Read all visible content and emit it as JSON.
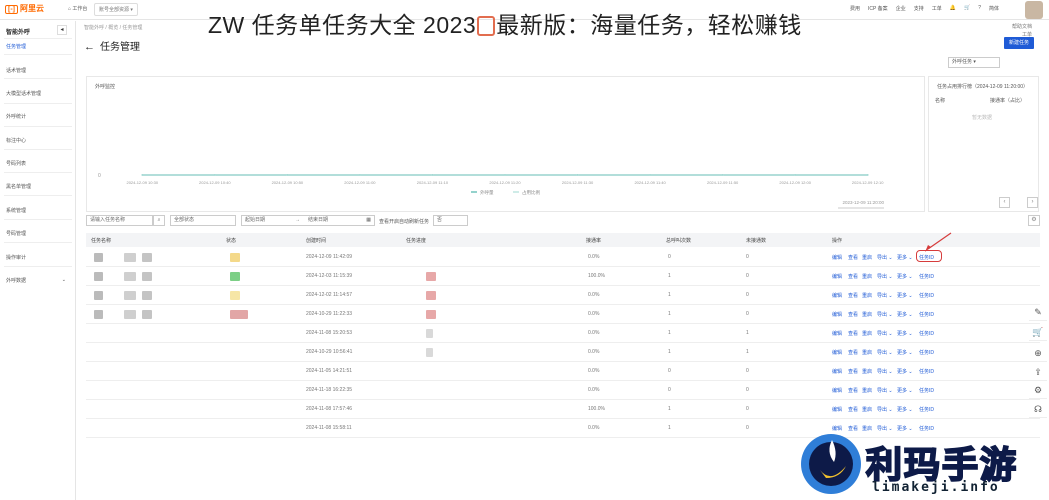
{
  "headline": {
    "prefix": "ZW 任务单任务大全 2023",
    "suffix": "最新版：海量任务，轻松赚钱"
  },
  "topbar": {
    "logo": "阿里云",
    "nav_home": "工作台",
    "search_placeholder": "账号全部资源",
    "right_items": [
      "费用",
      "ICP 备案",
      "企业",
      "支持",
      "工单",
      "简体"
    ]
  },
  "sidebar": {
    "heading": "智能外呼",
    "items": [
      {
        "label": "任务管理",
        "active": true
      },
      {
        "label": "话术管理",
        "active": false
      },
      {
        "label": "大模型话术管理",
        "active": false
      },
      {
        "label": "外呼统计",
        "active": false
      },
      {
        "label": "标注中心",
        "active": false
      },
      {
        "label": "号码列表",
        "active": false
      },
      {
        "label": "黑名单管理",
        "active": false
      },
      {
        "label": "系统管理",
        "active": false
      },
      {
        "label": "号码管理",
        "active": false
      },
      {
        "label": "操作审计",
        "active": false
      },
      {
        "label": "外呼数据",
        "active": false
      }
    ]
  },
  "breadcrumb": [
    "智能外呼",
    "概览",
    "任务管理"
  ],
  "page": {
    "title": "任务管理",
    "right_links": [
      "帮助文档",
      "工单"
    ],
    "create_button": "新建任务",
    "scope_select": "外呼任务"
  },
  "monitor_panel": {
    "title": "外呼监控",
    "legend": [
      "外呼量",
      "占用比例"
    ],
    "footer": "2023-12-09 11:20:00"
  },
  "chart_data": {
    "type": "line",
    "title": "外呼监控",
    "x": [
      "2024-12-09 10:30",
      "2024-12-09 10:40",
      "2024-12-09 10:50",
      "2024-12-09 11:00",
      "2024-12-09 11:10",
      "2024-12-09 11:20",
      "2024-12-09 11:30",
      "2024-12-09 11:40",
      "2024-12-09 11:50",
      "2024-12-09 12:00",
      "2024-12-09 12:10"
    ],
    "series": [
      {
        "name": "外呼量",
        "values": [
          0,
          0,
          0,
          0,
          0,
          0,
          0,
          0,
          0,
          0,
          0
        ]
      },
      {
        "name": "占用比例",
        "values": [
          0,
          0,
          0,
          0,
          0,
          0,
          0,
          0,
          0,
          0,
          0
        ]
      }
    ],
    "y_tick": "0",
    "grid": false,
    "legend_position": "bottom"
  },
  "rank_panel": {
    "title": "任务占用排行榜（2024-12-09 11:20:00）",
    "columns": [
      "名称",
      "接通率（占比）"
    ],
    "empty_text": "暂无数据"
  },
  "filters": {
    "search_placeholder": "请输入任务名称",
    "status_placeholder": "全部状态",
    "date_start": "起始日期",
    "date_end": "结束日期",
    "toggle_label": "查看开启自动刷新任务",
    "toggle_value": "否"
  },
  "table": {
    "columns": [
      "任务名称",
      "状态",
      "创建时间",
      "任务进度",
      "接通率",
      "总呼叫次数",
      "未接通数",
      "操作"
    ],
    "rows": [
      {
        "created": "2024-12-09 11:42:09",
        "rate": "0.0%",
        "calls": "0",
        "missed": "0",
        "highlight": true
      },
      {
        "created": "2024-12-03 11:15:39",
        "rate": "100.0%",
        "calls": "1",
        "missed": "0",
        "highlight": false
      },
      {
        "created": "2024-12-02 11:14:57",
        "rate": "0.0%",
        "calls": "1",
        "missed": "0",
        "highlight": false
      },
      {
        "created": "2024-10-29 11:22:33",
        "rate": "0.0%",
        "calls": "1",
        "missed": "0",
        "highlight": false
      },
      {
        "created": "2024-11-08 15:20:53",
        "rate": "0.0%",
        "calls": "1",
        "missed": "1",
        "highlight": false
      },
      {
        "created": "2024-10-29 10:56:41",
        "rate": "0.0%",
        "calls": "1",
        "missed": "1",
        "highlight": false
      },
      {
        "created": "2024-11-05 14:21:51",
        "rate": "0.0%",
        "calls": "0",
        "missed": "0",
        "highlight": false
      },
      {
        "created": "2024-11-18 16:22:35",
        "rate": "0.0%",
        "calls": "0",
        "missed": "0",
        "highlight": false
      },
      {
        "created": "2024-11-08 17:57:46",
        "rate": "100.0%",
        "calls": "1",
        "missed": "0",
        "highlight": false
      },
      {
        "created": "2024-11-08 15:58:11",
        "rate": "0.0%",
        "calls": "1",
        "missed": "0",
        "highlight": false
      }
    ],
    "ops": {
      "edit": "编辑",
      "view": "查看",
      "restart": "重启",
      "export": "导出",
      "more": "更多",
      "copy": "任务ID"
    }
  },
  "watermark": {
    "title": "利玛手游",
    "site": "limakeji.info"
  },
  "colors": {
    "accent": "#1f5bd6",
    "brand": "#ff6a00",
    "annotation": "#d63c3c",
    "chart_line": "#2aa59a"
  }
}
